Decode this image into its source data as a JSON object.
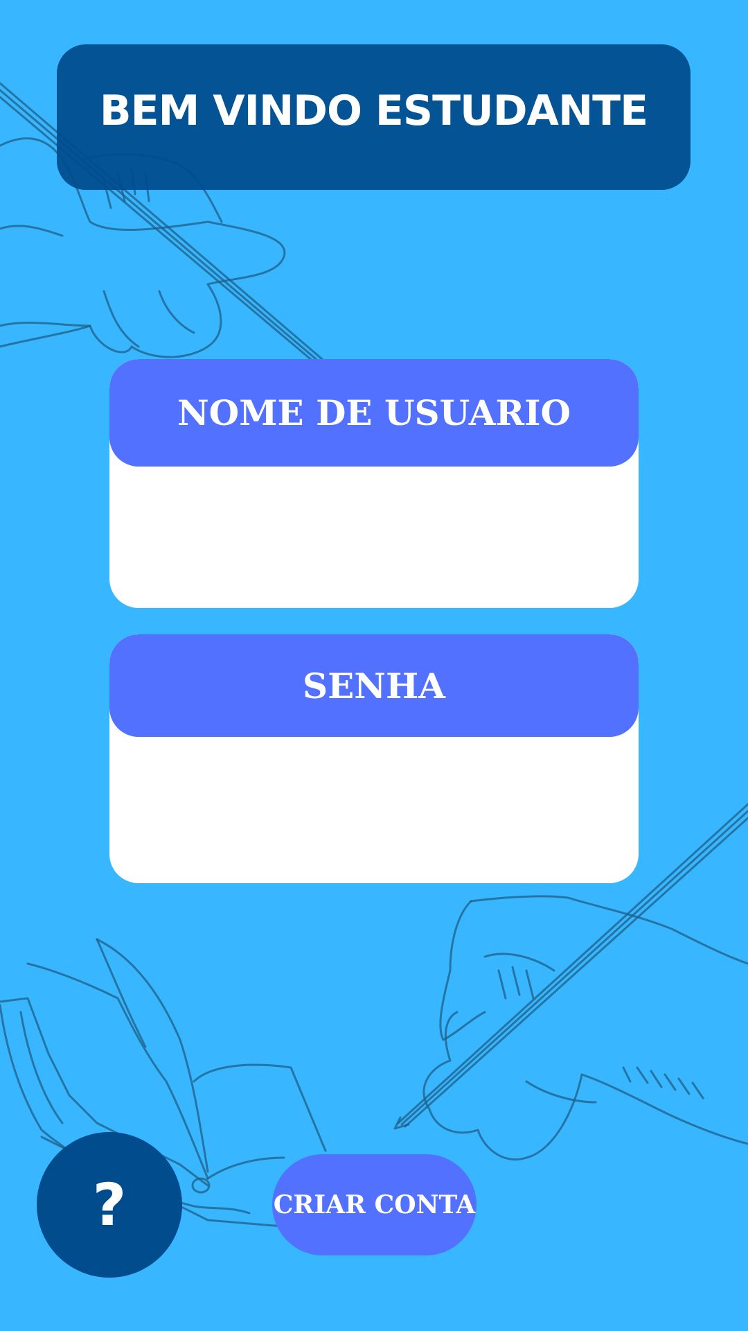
{
  "header": {
    "title": "BEM VINDO ESTUDANTE"
  },
  "form": {
    "username": {
      "label": "NOME DE USUARIO",
      "value": "",
      "placeholder": ""
    },
    "password": {
      "label": "SENHA",
      "value": "",
      "placeholder": ""
    }
  },
  "footer": {
    "help_label": "?",
    "create_account_label": "CRIAR CONTA"
  },
  "colors": {
    "background": "#38b6ff",
    "banner": "#004c8c",
    "accent": "#5271ff",
    "field_background": "#ffffff",
    "text": "#ffffff",
    "sketch_lines": "#1f5f86"
  },
  "icons": {
    "background_art": [
      "hand-with-pencil-illustration",
      "hand-with-pencil-illustration",
      "open-book-illustration"
    ]
  }
}
